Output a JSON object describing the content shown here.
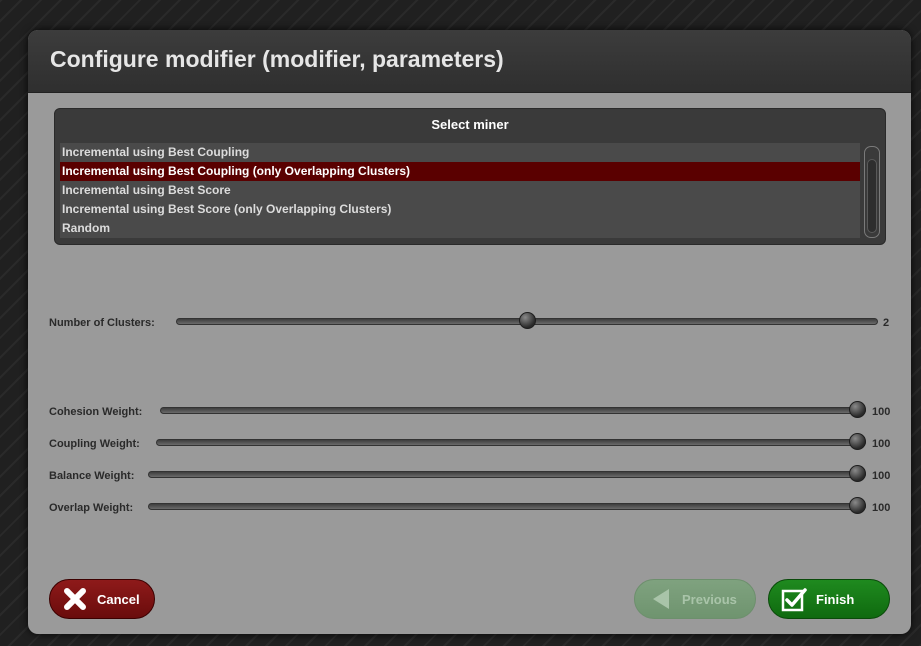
{
  "dialog": {
    "title": "Configure modifier (modifier, parameters)"
  },
  "miner_list": {
    "header": "Select miner",
    "items": [
      {
        "label": "Incremental using Best Coupling",
        "selected": false
      },
      {
        "label": "Incremental using Best Coupling (only Overlapping Clusters)",
        "selected": true
      },
      {
        "label": "Incremental using Best Score",
        "selected": false
      },
      {
        "label": "Incremental using Best Score (only Overlapping Clusters)",
        "selected": false
      },
      {
        "label": "Random",
        "selected": false
      }
    ]
  },
  "sliders": {
    "clusters": {
      "label": "Number of Clusters:",
      "value": "2",
      "level": 0.5
    },
    "cohesion": {
      "label": "Cohesion Weight:",
      "value": "100",
      "level": 1.0
    },
    "coupling": {
      "label": "Coupling Weight:",
      "value": "100",
      "level": 1.0
    },
    "balance": {
      "label": "Balance Weight:",
      "value": "100",
      "level": 1.0
    },
    "overlap": {
      "label": "Overlap Weight:",
      "value": "100",
      "level": 1.0
    }
  },
  "buttons": {
    "cancel": {
      "label": "Cancel",
      "icon": "x-icon"
    },
    "previous": {
      "label": "Previous",
      "icon": "arrow-left-icon",
      "enabled": false
    },
    "finish": {
      "label": "Finish",
      "icon": "checkbox-check-icon"
    }
  },
  "colors": {
    "selected_row": "#5a0000",
    "cancel": "#8e1a1a",
    "finish": "#1f8a1f",
    "previous_disabled": "#7fa27f"
  }
}
